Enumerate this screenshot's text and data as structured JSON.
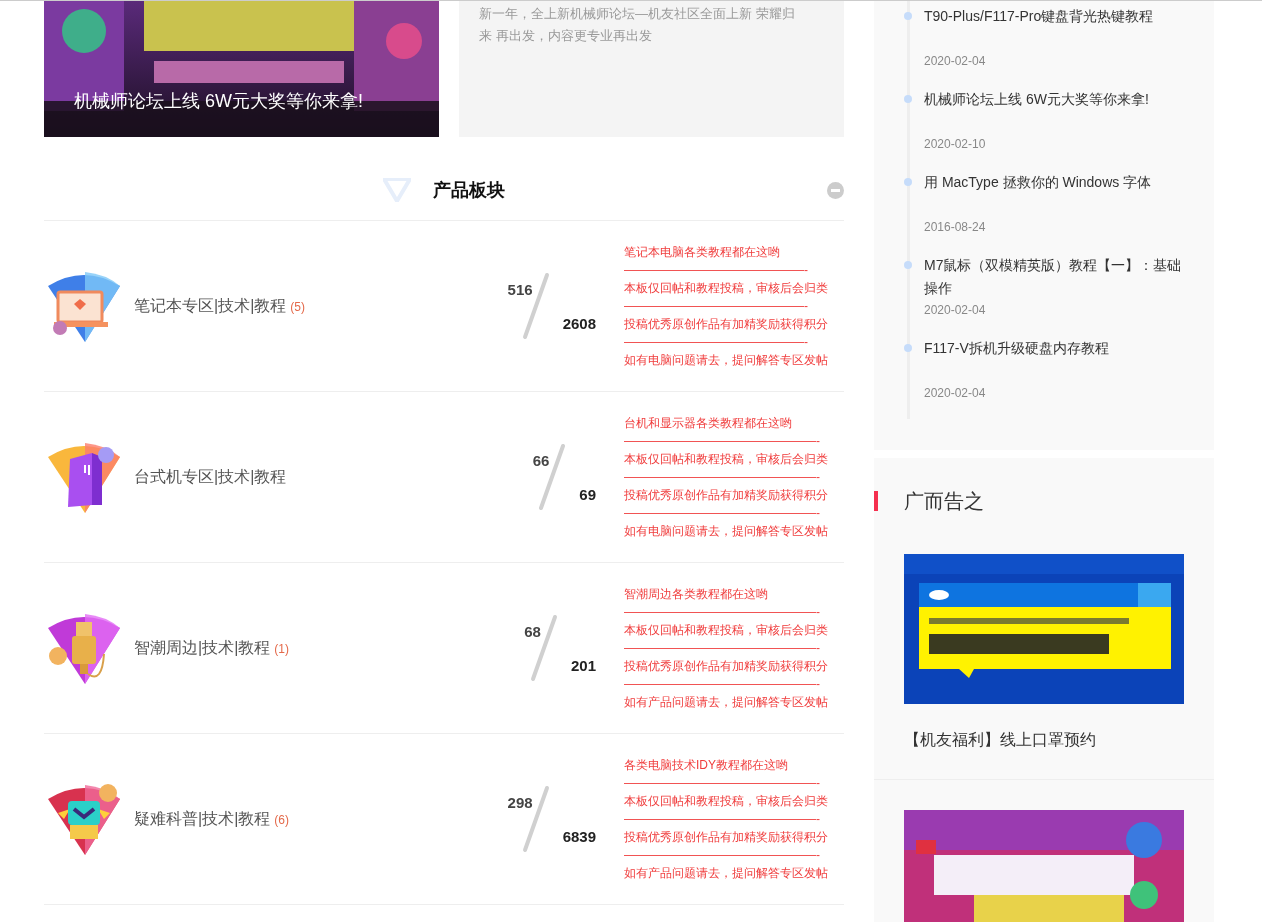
{
  "featured": {
    "caption": "机械师论坛上线 6W元大奖等你来拿!"
  },
  "intro": {
    "text": "新一年，全上新机械师论坛—机友社区全面上新 荣耀归来 再出发，内容更专业再出发"
  },
  "forum_section": {
    "title": "产品板块",
    "expanded": true
  },
  "forums": [
    {
      "kind": "laptop",
      "name": "笔记本专区|技术|教程",
      "new_count": "(5)",
      "threads": "516",
      "posts": "2608",
      "description_lines": [
        "笔记本电脑各类教程都在这哟",
        "———————————————-",
        "本板仅回帖和教程投稿，审核后会归类",
        "———————————————-",
        "投稿优秀原创作品有加精奖励获得积分",
        "———————————————-",
        "如有电脑问题请去，提问解答专区发帖"
      ]
    },
    {
      "kind": "tower",
      "name": "台式机专区|技术|教程",
      "threads": "66",
      "posts": "69",
      "description_lines": [
        "台机和显示器各类教程都在这哟",
        "————————————————-",
        "本板仅回帖和教程投稿，审核后会归类",
        "————————————————-",
        "投稿优秀原创作品有加精奖励获得积分",
        "————————————————-",
        "如有电脑问题请去，提问解答专区发帖"
      ]
    },
    {
      "kind": "plug",
      "name": "智潮周边|技术|教程",
      "new_count": "(1)",
      "threads": "68",
      "posts": "201",
      "description_lines": [
        "智潮周边各类教程都在这哟",
        "————————————————-",
        "本板仅回帖和教程投稿，审核后会归类",
        "————————————————-",
        "投稿优秀原创作品有加精奖励获得积分",
        "————————————————-",
        "如有产品问题请去，提问解答专区发帖"
      ]
    },
    {
      "kind": "box",
      "name": "疑难科普|技术|教程",
      "new_count": "(6)",
      "threads": "298",
      "posts": "6839",
      "description_lines": [
        "各类电脑技术IDY教程都在这哟",
        "————————————————-",
        "本板仅回帖和教程投稿，审核后会归类",
        "————————————————-",
        "投稿优秀原创作品有加精奖励获得积分",
        "————————————————-",
        "如有产品问题请去，提问解答专区发帖"
      ]
    }
  ],
  "sidebar": {
    "timeline": [
      {
        "title": "T90-Plus/F117-Pro键盘背光热键教程",
        "date": "2020-02-04"
      },
      {
        "title": "机械师论坛上线 6W元大奖等你来拿!",
        "date": "2020-02-10"
      },
      {
        "title": "用 MacType 拯救你的 Windows 字体",
        "date": "2016-08-24"
      },
      {
        "title": "M7鼠标（双模精英版）教程【一】：基础操作",
        "date": "2020-02-04"
      },
      {
        "title": "F117-V拆机升级硬盘内存教程",
        "date": "2020-02-04"
      }
    ],
    "ad_section": {
      "title": "广而告之",
      "ads": [
        {
          "kind": "blue",
          "caption": "【机友福利】线上口罩预约"
        },
        {
          "kind": "purple"
        }
      ]
    }
  }
}
